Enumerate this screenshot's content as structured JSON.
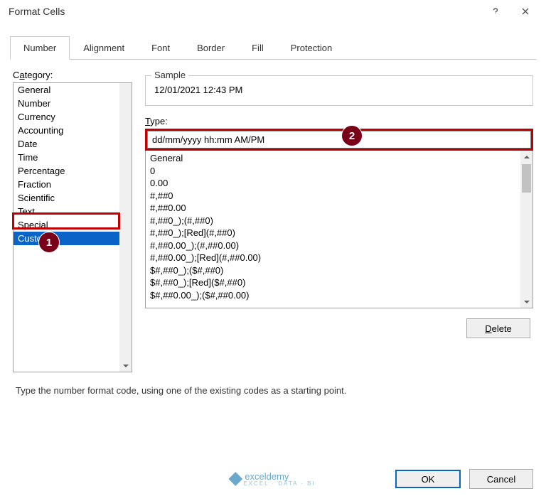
{
  "dialog": {
    "title": "Format Cells"
  },
  "tabs": [
    "Number",
    "Alignment",
    "Font",
    "Border",
    "Fill",
    "Protection"
  ],
  "category": {
    "label_pre": "C",
    "label_u": "a",
    "label_post": "tegory:",
    "items": [
      "General",
      "Number",
      "Currency",
      "Accounting",
      "Date",
      "Time",
      "Percentage",
      "Fraction",
      "Scientific",
      "Text",
      "Special",
      "Custom"
    ],
    "selected": "Custom"
  },
  "sample": {
    "title": "Sample",
    "value": "12/01/2021 12:43 PM"
  },
  "type": {
    "label_u": "T",
    "label_post": "ype:",
    "value": "dd/mm/yyyy hh:mm AM/PM",
    "options": [
      "General",
      "0",
      "0.00",
      "#,##0",
      "#,##0.00",
      "#,##0_);(#,##0)",
      "#,##0_);[Red](#,##0)",
      "#,##0.00_);(#,##0.00)",
      "#,##0.00_);[Red](#,##0.00)",
      "$#,##0_);($#,##0)",
      "$#,##0_);[Red]($#,##0)",
      "$#,##0.00_);($#,##0.00)"
    ]
  },
  "delete": {
    "u": "D",
    "post": "elete"
  },
  "hint": "Type the number format code, using one of the existing codes as a starting point.",
  "footer": {
    "ok": "OK",
    "cancel": "Cancel"
  },
  "callouts": {
    "one": "1",
    "two": "2"
  },
  "watermark": {
    "name": "exceldemy",
    "sub": "EXCEL · DATA · BI"
  }
}
